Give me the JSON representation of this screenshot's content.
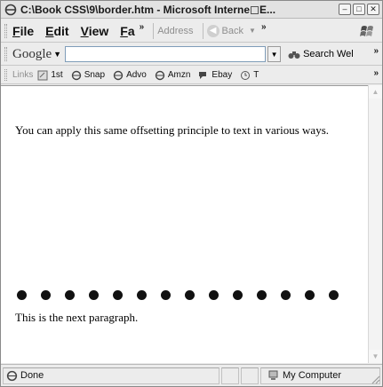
{
  "window": {
    "title": "C:\\Book CSS\\9\\border.htm - Microsoft Interne",
    "title_tail": "E..."
  },
  "menu": {
    "items": [
      {
        "accel": "F",
        "rest": "ile"
      },
      {
        "accel": "E",
        "rest": "dit"
      },
      {
        "accel": "V",
        "rest": "iew"
      },
      {
        "accel": "F",
        "rest": "a"
      }
    ],
    "address_label": "Address",
    "back_label": "Back"
  },
  "google": {
    "logo": "Google",
    "search_value": "",
    "search_web_label": "Search Wel"
  },
  "links": {
    "label": "Links",
    "items": [
      {
        "label": "1st",
        "icon": "page-icon"
      },
      {
        "label": "Snap",
        "icon": "ie-page-icon"
      },
      {
        "label": "Advo",
        "icon": "ie-page-icon"
      },
      {
        "label": "Amzn",
        "icon": "ie-page-icon"
      },
      {
        "label": "Ebay",
        "icon": "chat-icon"
      },
      {
        "label": "T",
        "icon": "clock-icon"
      }
    ]
  },
  "page": {
    "paragraph1": "You can apply this same offsetting principle to text in various ways.",
    "paragraph2": "This is the next paragraph."
  },
  "status": {
    "text": "Done",
    "zone": "My Computer"
  }
}
